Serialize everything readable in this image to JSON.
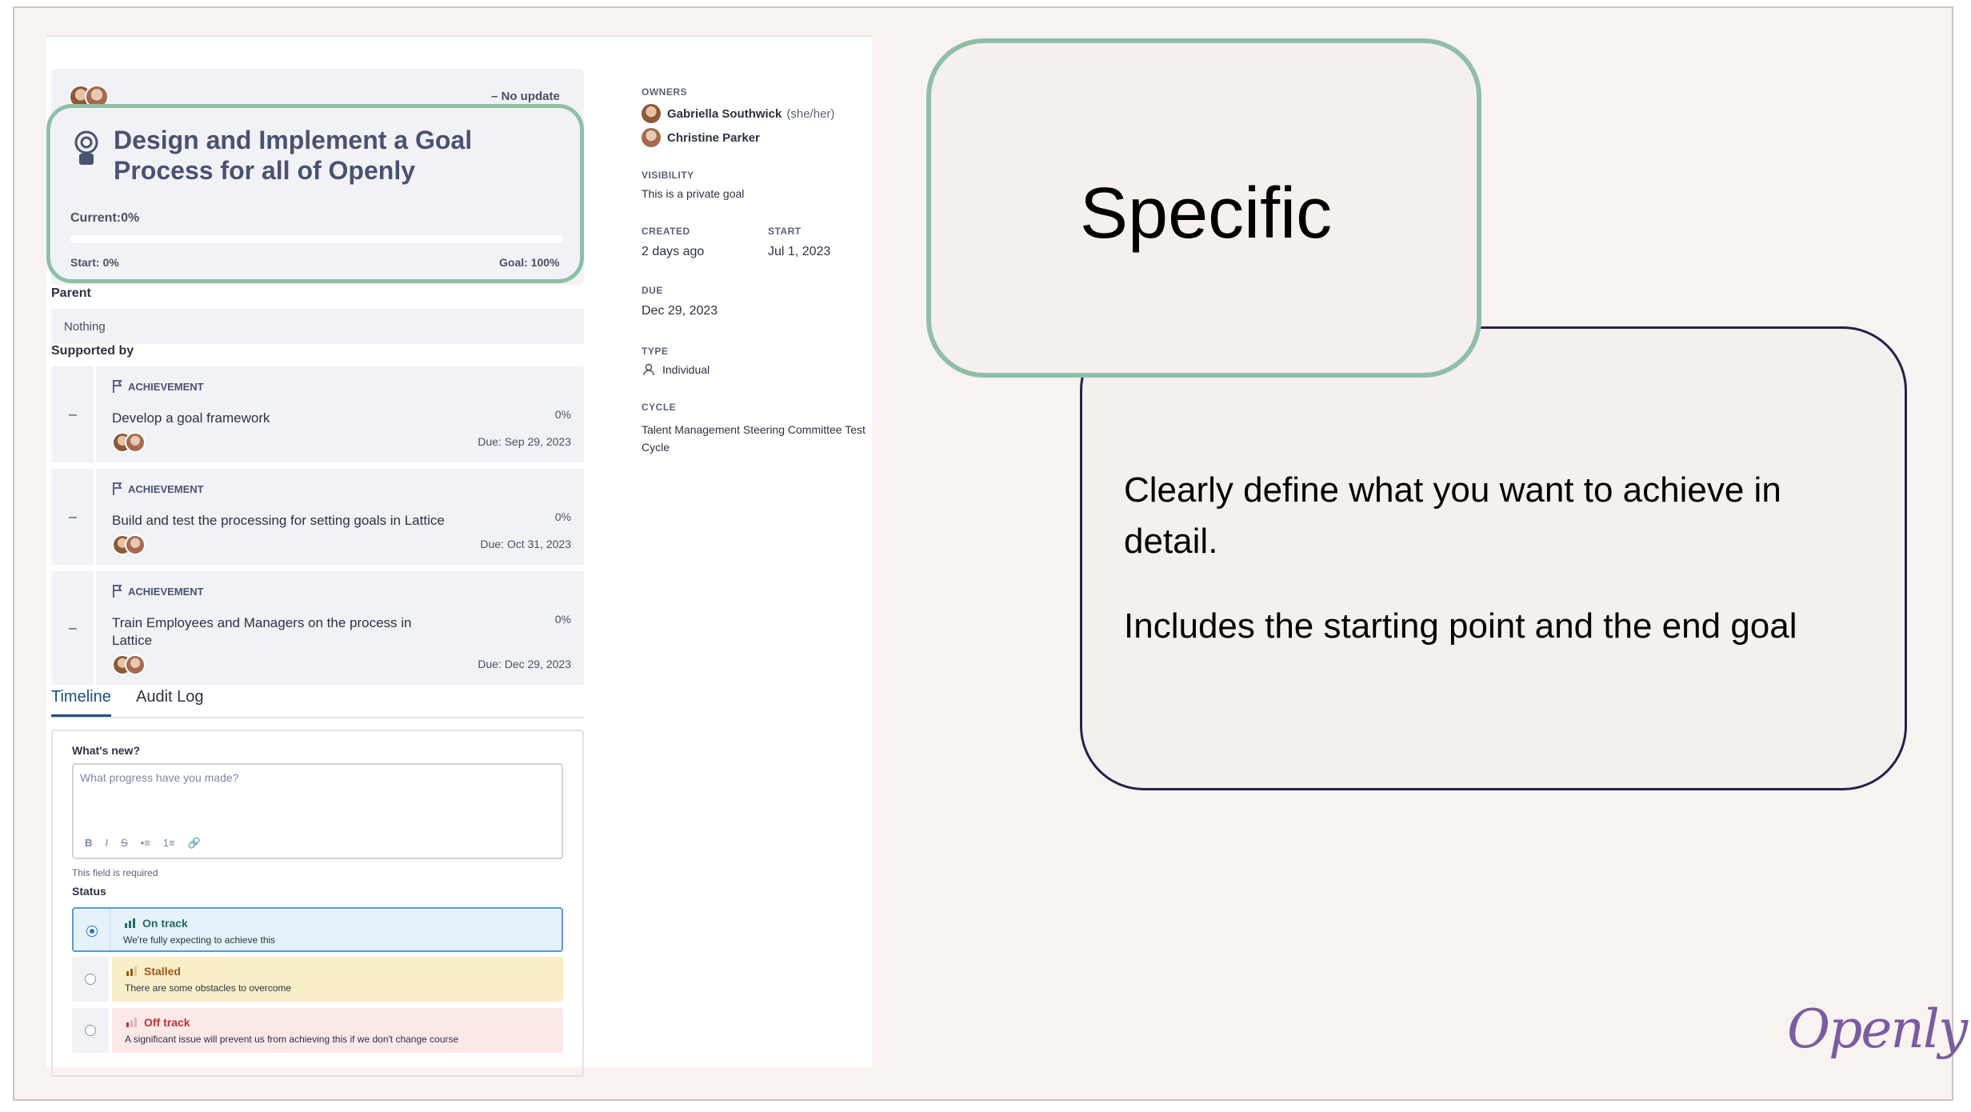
{
  "goal": {
    "no_update": "–  No update",
    "title": "Design and Implement a Goal Process for all of Openly",
    "current": "Current:0%",
    "progress_fraction": 0,
    "start": "Start: 0%",
    "goal": "Goal: 100%"
  },
  "parent": {
    "label": "Parent",
    "value": "Nothing"
  },
  "supported_by": {
    "label": "Supported by",
    "tag": "ACHIEVEMENT",
    "dash": "–",
    "items": [
      {
        "name": "Develop a goal framework",
        "pct": "0%",
        "due": "Due: Sep 29, 2023"
      },
      {
        "name": "Build and test the processing for setting goals in Lattice",
        "pct": "0%",
        "due": "Due: Oct 31, 2023"
      },
      {
        "name": "Train Employees and Managers on the process in Lattice",
        "pct": "0%",
        "due": "Due: Dec 29, 2023"
      }
    ]
  },
  "tabs": {
    "timeline": "Timeline",
    "audit": "Audit Log"
  },
  "form": {
    "whats_new": "What's new?",
    "placeholder": "What progress have you made?",
    "toolbar": [
      "B",
      "I",
      "S",
      "•≡",
      "1≡",
      "🔗"
    ],
    "required": "This field is required",
    "status_label": "Status",
    "options": [
      {
        "title": "On track",
        "desc": "We're fully expecting to achieve this",
        "color": "#1f6f5a"
      },
      {
        "title": "Stalled",
        "desc": "There are some obstacles to overcome",
        "color": "#a0581a"
      },
      {
        "title": "Off track",
        "desc": "A significant issue will prevent us from achieving this if we don't change course",
        "color": "#b8323b"
      }
    ]
  },
  "meta": {
    "owners_label": "OWNERS",
    "owner1": "Gabriella Southwick",
    "owner1_pronoun": "(she/her)",
    "owner2": "Christine Parker",
    "visibility_label": "VISIBILITY",
    "visibility": "This is a private goal",
    "created_label": "CREATED",
    "created": "2 days ago",
    "start_label": "START",
    "start": "Jul 1, 2023",
    "due_label": "DUE",
    "due": "Dec 29, 2023",
    "type_label": "TYPE",
    "type": "Individual",
    "cycle_label": "CYCLE",
    "cycle": "Talent Management Steering Committee Test Cycle"
  },
  "slide": {
    "specific": "Specific",
    "desc1": "Clearly define what you want to achieve in detail.",
    "desc2": "Includes the starting point and the end goal",
    "logo": "Openly"
  },
  "colors": {
    "highlight": "#8fbfa6",
    "desc_border": "#27204a",
    "accent_blue": "#1f4d7a"
  }
}
